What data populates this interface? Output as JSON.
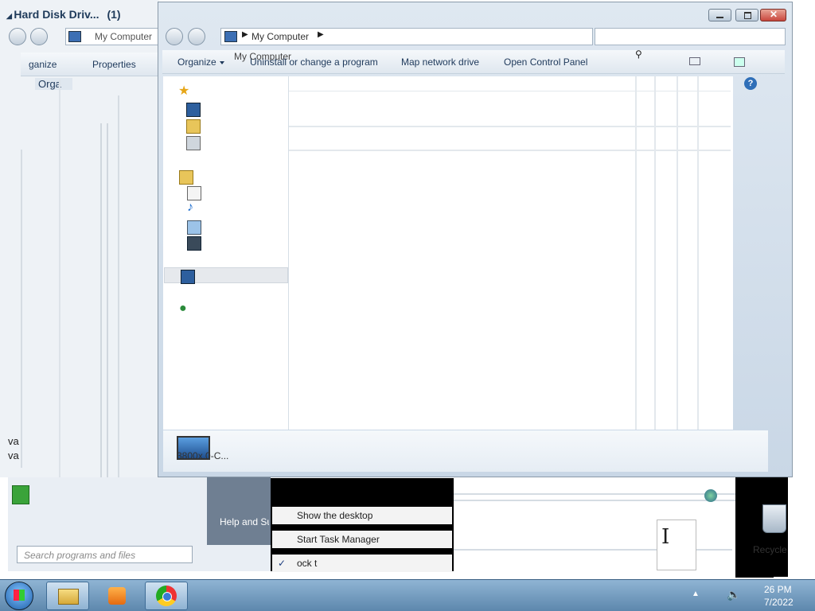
{
  "background_window": {
    "title": "Hard Disk Driv...",
    "title_count": "(1)",
    "address": "My Computer",
    "organize": "ganize",
    "properties": "Properties",
    "orga": "Orga",
    "truncated_lines": [
      "va",
      "va"
    ]
  },
  "main_window": {
    "address_text": "My Computer",
    "ghost_address": "My Computer",
    "toolbar": {
      "organize": "Organize",
      "uninstall": "Uninstall or change a program",
      "map_drive": "Map network drive",
      "control_panel": "Open Control Panel"
    },
    "bottom_item_label": "3800x.0-C..."
  },
  "start_menu": {
    "help": "Help and Su",
    "search_placeholder": "Search programs and files"
  },
  "context_menu": {
    "items": [
      {
        "label": "Show the desktop",
        "checked": false
      },
      {
        "label": "Start Task Manager",
        "checked": false
      },
      {
        "label": "ock t",
        "checked": true
      }
    ]
  },
  "desktop": {
    "recycle_label": "Recycle"
  },
  "taskbar": {
    "clock_time": "26 PM",
    "clock_date": "7/2022",
    "apps": [
      "start-orb",
      "explorer",
      "media-player",
      "chrome"
    ]
  },
  "colors": {
    "taskbar": "#6f98bd",
    "window_frame": "#dfe6ee",
    "close_button": "#c9473d",
    "context_bg": "#000000"
  }
}
